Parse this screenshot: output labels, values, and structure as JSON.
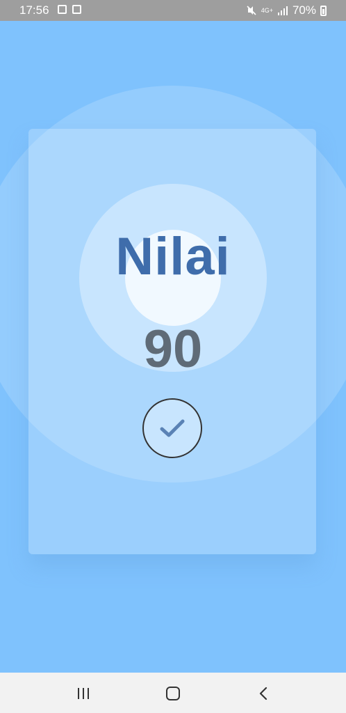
{
  "status_bar": {
    "time": "17:56",
    "network": "4G+",
    "battery": "70%",
    "icons": [
      "photo-icon",
      "gallery-icon",
      "mute-icon",
      "signal-icon",
      "battery-icon"
    ]
  },
  "result": {
    "title": "Nilai",
    "score": "90",
    "confirm_icon": "check-icon"
  },
  "nav_bar": {
    "icons": [
      "recent-apps-icon",
      "home-icon",
      "back-icon"
    ]
  },
  "colors": {
    "background": "#7fc2fd",
    "title": "#3f6dab",
    "score": "#5f6b77",
    "check": "#5a82b5"
  }
}
